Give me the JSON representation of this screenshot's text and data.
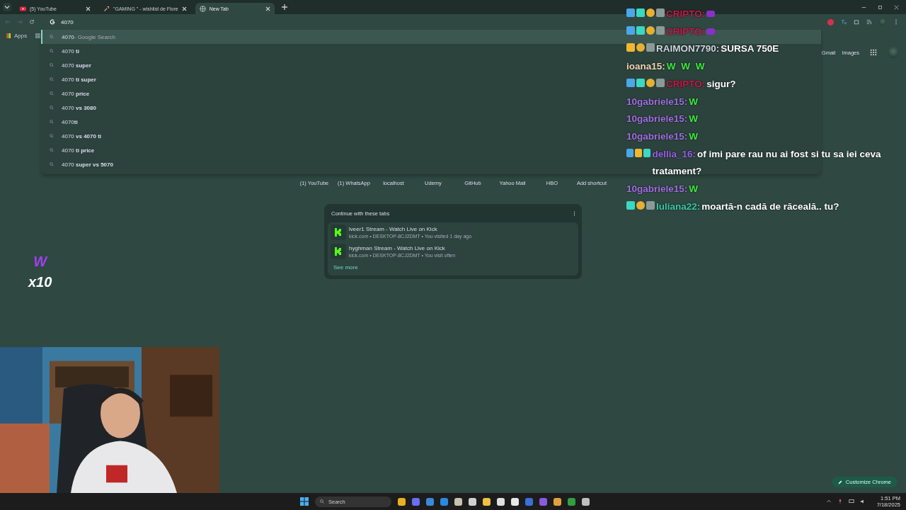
{
  "tabs": [
    {
      "title": "(5) YouTube",
      "kind": "video",
      "selected": false
    },
    {
      "title": "\"GAMING \" - wishlist de Flore",
      "kind": "tool",
      "selected": false
    },
    {
      "title": "New Tab",
      "kind": "globe",
      "selected": true
    }
  ],
  "omnibox": {
    "value": "4070"
  },
  "bookmarks": {
    "apps_label": "Apps"
  },
  "suggestions": [
    {
      "text": "4070",
      "suffix": "- Google Search",
      "selected": true
    },
    {
      "text": "4070 **ti**",
      "selected": false
    },
    {
      "text": "4070 **super**",
      "selected": false
    },
    {
      "text": "4070 **ti super**",
      "selected": false
    },
    {
      "text": "4070 **price**",
      "selected": false
    },
    {
      "text": "4070 **vs 3080**",
      "selected": false
    },
    {
      "text": "4070**ti**",
      "selected": false
    },
    {
      "text": "4070 **vs 4070 ti**",
      "selected": false
    },
    {
      "text": "4070 **ti price**",
      "selected": false
    },
    {
      "text": "4070 **super vs 5070**",
      "selected": false
    }
  ],
  "header_links": [
    "Gmail",
    "Images"
  ],
  "shortcuts": [
    "(1) YouTube",
    "(1) WhatsApp",
    "localhost",
    "Udemy",
    "GitHub",
    "Yahoo Mail",
    "HBO",
    "Add shortcut"
  ],
  "continue_card": {
    "title": "Continue with these tabs",
    "items": [
      {
        "title": "lveer1 Stream - Watch Live on Kick",
        "meta": "kick.com • DESKTOP-8CJ2DMT • You visited 1 day ago"
      },
      {
        "title": "hyghman Stream - Watch Live on Kick",
        "meta": "kick.com • DESKTOP-8CJ2DMT • You visit often"
      }
    ],
    "see_more": "See more"
  },
  "customize_button": "Customize Chrome",
  "chat": [
    {
      "badges": [
        {
          "kind": "sword"
        },
        {
          "kind": "box"
        },
        {
          "kind": "coin"
        },
        {
          "kind": "pencil"
        }
      ],
      "user": "CRIPTO:",
      "color": "#c8194a",
      "kind": "emote-image"
    },
    {
      "badges": [
        {
          "kind": "sword"
        },
        {
          "kind": "box"
        },
        {
          "kind": "coin"
        },
        {
          "kind": "pencil"
        }
      ],
      "user": "CRIPTO:",
      "color": "#c8194a",
      "kind": "emote-image"
    },
    {
      "badges": [
        {
          "kind": "crown"
        },
        {
          "kind": "coin"
        },
        {
          "kind": "pencil"
        }
      ],
      "user": "RAIMON7790:",
      "color": "#d0d6e0",
      "kind": "text",
      "text": "SURSA 750E"
    },
    {
      "user": "ioana15:",
      "color": "#f0d8b8",
      "kind": "emote",
      "text": "W  W  W"
    },
    {
      "badges": [
        {
          "kind": "sword"
        },
        {
          "kind": "box"
        },
        {
          "kind": "coin"
        },
        {
          "kind": "pencil"
        }
      ],
      "user": "CRIPTO:",
      "color": "#c8194a",
      "kind": "text",
      "text": "sigur?"
    },
    {
      "user": "10gabriele15:",
      "color": "#a070e0",
      "kind": "emote",
      "text": "W"
    },
    {
      "user": "10gabriele15:",
      "color": "#a070e0",
      "kind": "emote",
      "text": "W"
    },
    {
      "user": "10gabriele15:",
      "color": "#a070e0",
      "kind": "emote",
      "text": "W"
    },
    {
      "badges": [
        {
          "kind": "sword"
        },
        {
          "kind": "crown"
        },
        {
          "kind": "box"
        }
      ],
      "user": "dellia_16:",
      "color": "#9a60e8",
      "kind": "text",
      "text": "of imi pare rau nu ai fost si tu sa iei ceva tratament?"
    },
    {
      "user": "10gabriele15:",
      "color": "#a070e0",
      "kind": "emote",
      "text": "W"
    },
    {
      "badges": [
        {
          "kind": "box"
        },
        {
          "kind": "coin"
        },
        {
          "kind": "pencil"
        }
      ],
      "user": "Iuliana22:",
      "color": "#3cc8a8",
      "kind": "text",
      "text": "moartă-n cadă de răceală.. tu?"
    }
  ],
  "combo": {
    "emote": "W",
    "count": "x10"
  },
  "taskbar": {
    "search_placeholder": "Search",
    "apps": [
      {
        "color": "#e8b020"
      },
      {
        "color": "#6a6ef0"
      },
      {
        "color": "#3a8ad8"
      },
      {
        "color": "#2a8ae0"
      },
      {
        "color": "#c8c0b0"
      },
      {
        "color": "#d0d0d0"
      },
      {
        "color": "#f0c040"
      },
      {
        "color": "#e0e0e0"
      },
      {
        "color": "#e8e8e8"
      },
      {
        "color": "#3a70d8"
      },
      {
        "color": "#8a5ae0"
      },
      {
        "color": "#e0a040"
      },
      {
        "color": "#30a040"
      },
      {
        "color": "#c0c0c0"
      }
    ],
    "time": "1:51 PM",
    "date": "7/18/2025"
  }
}
